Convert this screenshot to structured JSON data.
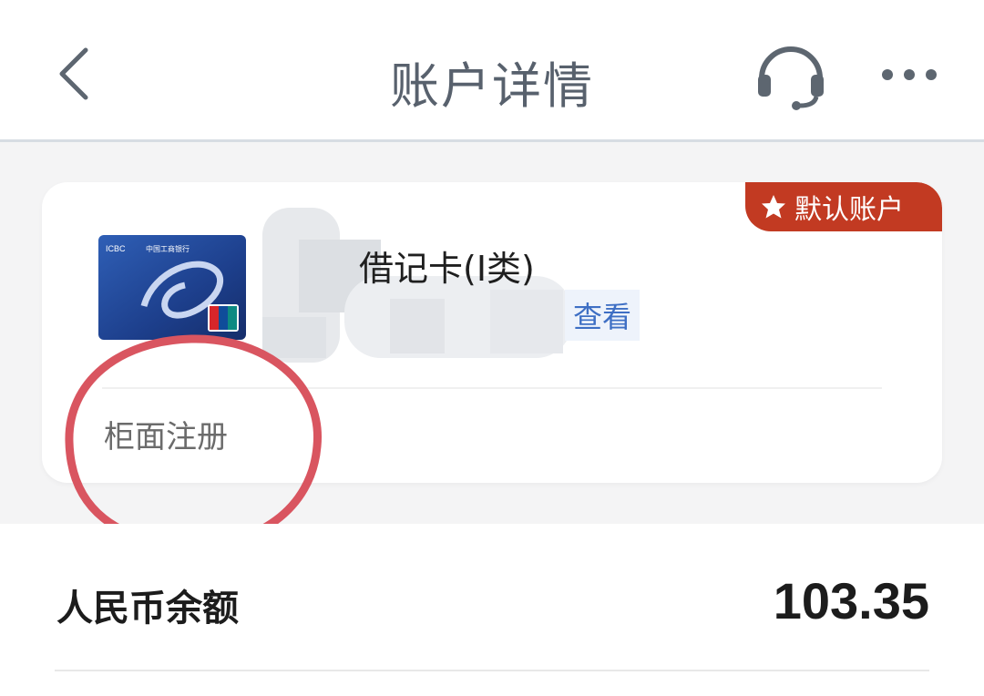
{
  "header": {
    "title": "账户详情",
    "back_icon": "chevron-left-icon",
    "headset_icon": "headset-icon",
    "more_icon": "more-dots-icon"
  },
  "card": {
    "badge_label": "默认账户",
    "card_type": "借记卡(Ⅰ类)",
    "view_label": "查看",
    "registration_label": "柜面注册",
    "card_image_brand_text": "ICBC 中国工商银行",
    "accent_color": "#c23a22",
    "link_color": "#3e6fc4"
  },
  "balance": {
    "label": "人民币余额",
    "value": "103.35"
  }
}
